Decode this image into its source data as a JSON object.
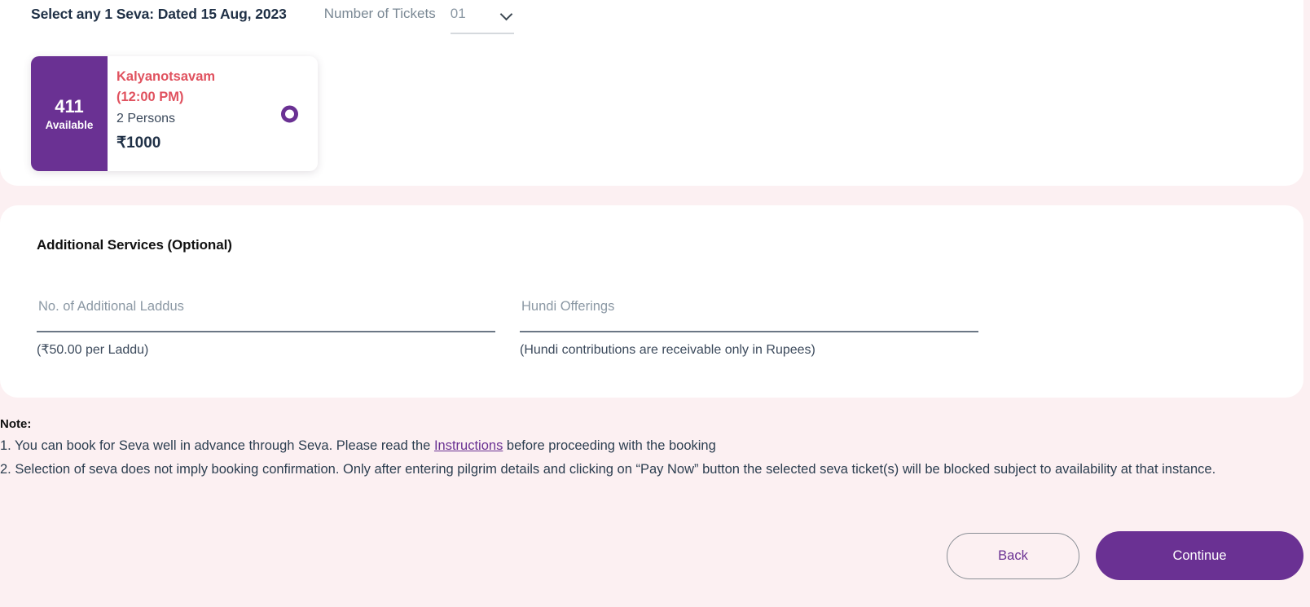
{
  "page": {
    "background_color": "#fcf0f2",
    "accent_purple": "#6a3193",
    "accent_rose": "#e0525f"
  },
  "header": {
    "title": "Select any 1 Seva: Dated 15 Aug, 2023",
    "tickets_label": "Number of Tickets",
    "tickets_value": "01",
    "tickets_options": [
      "01"
    ]
  },
  "seva_card": {
    "available_count": "411",
    "available_label": "Available",
    "name": "Kalyanotsavam",
    "time": "(12:00 PM)",
    "persons": "2 Persons",
    "price": "₹1000",
    "selected": true
  },
  "additional_services": {
    "heading": "Additional Services (Optional)",
    "laddus": {
      "placeholder": "No. of Additional Laddus",
      "value": "",
      "hint": "(₹50.00 per Laddu)"
    },
    "hundi": {
      "placeholder": "Hundi Offerings",
      "value": "",
      "hint": "(Hundi contributions are receivable only in Rupees)"
    }
  },
  "note": {
    "title": "Note:",
    "line1_before": "1. You can book for Seva well in advance through Seva. Please read the ",
    "line1_link": "Instructions",
    "line1_after": " before proceeding with the booking",
    "line2": "2. Selection of seva does not imply booking confirmation. Only after entering pilgrim details and clicking on “Pay Now” button the selected seva ticket(s) will be blocked subject to availability at that instance."
  },
  "footer": {
    "back_label": "Back",
    "continue_label": "Continue"
  }
}
